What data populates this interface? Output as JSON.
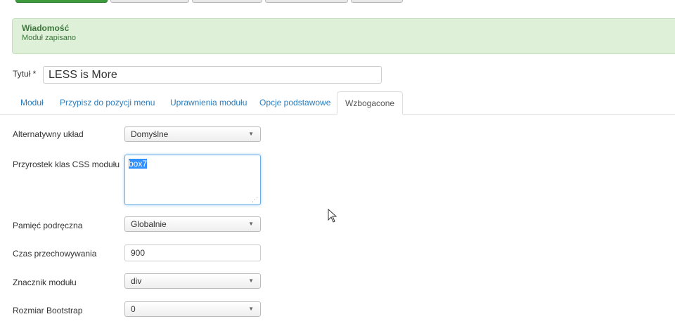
{
  "message": {
    "title": "Wiadomość",
    "text": "Moduł zapisano"
  },
  "title_field": {
    "label": "Tytuł *",
    "value": "LESS is More"
  },
  "tabs": [
    {
      "label": "Moduł",
      "active": false
    },
    {
      "label": "Przypisz do pozycji menu",
      "active": false
    },
    {
      "label": "Uprawnienia modułu",
      "active": false
    },
    {
      "label": "Opcje podstawowe",
      "active": false
    },
    {
      "label": "Wzbogacone",
      "active": true
    }
  ],
  "fields": {
    "layout": {
      "label": "Alternatywny układ",
      "value": "Domyślne"
    },
    "css_suffix": {
      "label": "Przyrostek klas CSS modułu",
      "value": "box7"
    },
    "cache": {
      "label": "Pamięć podręczna",
      "value": "Globalnie"
    },
    "cache_time": {
      "label": "Czas przechowywania",
      "value": "900"
    },
    "module_tag": {
      "label": "Znacznik modułu",
      "value": "div"
    },
    "bootstrap_size": {
      "label": "Rozmiar Bootstrap",
      "value": "0"
    }
  },
  "colors": {
    "message_bg": "#dff0d8",
    "message_text": "#3c763d",
    "link": "#2a7cbd",
    "primary_button": "#3c9a3c"
  },
  "icons": {
    "dropdown": "chevron-down-icon",
    "resize": "resize-grip-icon",
    "cursor": "mouse-pointer-icon"
  }
}
